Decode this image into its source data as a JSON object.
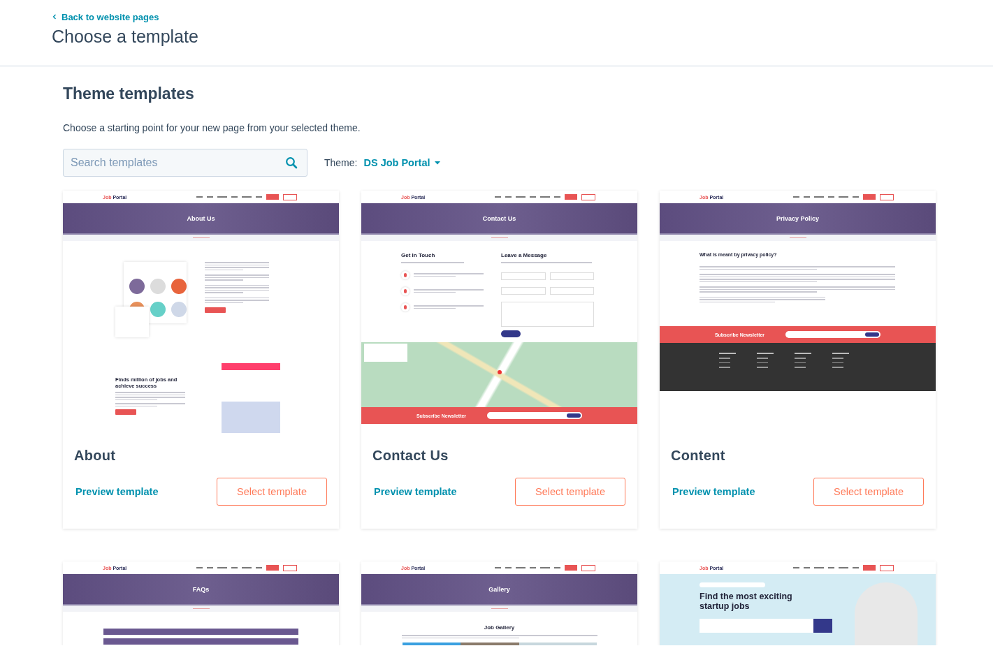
{
  "header": {
    "back_link": "Back to website pages",
    "title": "Choose a template"
  },
  "section": {
    "heading": "Theme templates",
    "description": "Choose a starting point for your new page from your selected theme.",
    "search": {
      "placeholder": "Search templates"
    },
    "theme_label": "Theme:",
    "theme_value": "DS Job Portal"
  },
  "templates": [
    {
      "kind": "about",
      "name": "About",
      "preview_label": "Preview template",
      "select_label": "Select template",
      "thumbnail": {
        "logo": "Job Portal",
        "hero": "About Us",
        "headings": [
          "Finds million of jobs and achieve success"
        ]
      }
    },
    {
      "kind": "contact",
      "name": "Contact Us",
      "preview_label": "Preview template",
      "select_label": "Select template",
      "thumbnail": {
        "logo": "Job Portal",
        "hero": "Contact Us",
        "headings": [
          "Get In Touch",
          "Leave a Message",
          "Subscribe Newsletter"
        ]
      }
    },
    {
      "kind": "privacy",
      "name": "Content",
      "preview_label": "Preview template",
      "select_label": "Select template",
      "thumbnail": {
        "logo": "Job Portal",
        "hero": "Privacy Policy",
        "headings": [
          "What is meant by privacy policy?",
          "Subscribe Newsletter"
        ]
      }
    },
    {
      "kind": "faq",
      "thumbnail": {
        "logo": "Job Portal",
        "hero": "FAQs"
      }
    },
    {
      "kind": "gallery",
      "thumbnail": {
        "logo": "Job Portal",
        "hero": "Gallery",
        "headings": [
          "Job Gallery"
        ]
      }
    },
    {
      "kind": "home",
      "thumbnail": {
        "logo": "Job Portal",
        "headings": [
          "Find the most exciting startup jobs"
        ]
      }
    }
  ]
}
